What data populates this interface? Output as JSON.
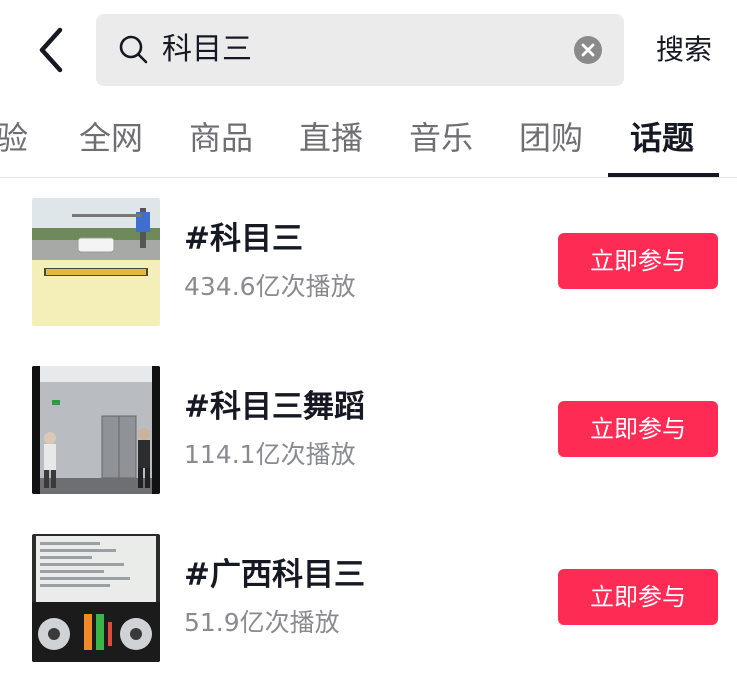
{
  "search": {
    "query": "科目三",
    "action_label": "搜索"
  },
  "tabs": [
    {
      "label": "验"
    },
    {
      "label": "全网"
    },
    {
      "label": "商品"
    },
    {
      "label": "直播"
    },
    {
      "label": "音乐"
    },
    {
      "label": "团购"
    },
    {
      "label": "话题",
      "active": true
    }
  ],
  "topics": [
    {
      "title": "#科目三",
      "plays": "434.6亿次播放",
      "join_label": "立即参与",
      "thumbnail": "road-driving-scene-with-yellow-caption"
    },
    {
      "title": "#科目三舞蹈",
      "plays": "114.1亿次播放",
      "join_label": "立即参与",
      "thumbnail": "dance-in-elevator-hall"
    },
    {
      "title": "#广西科目三",
      "plays": "51.9亿次播放",
      "join_label": "立即参与",
      "thumbnail": "dj-controller-laptop"
    }
  ],
  "colors": {
    "accent": "#fe2c55",
    "text_primary": "#161823",
    "text_secondary": "#8a8b91",
    "search_bg": "#ebebeb"
  }
}
